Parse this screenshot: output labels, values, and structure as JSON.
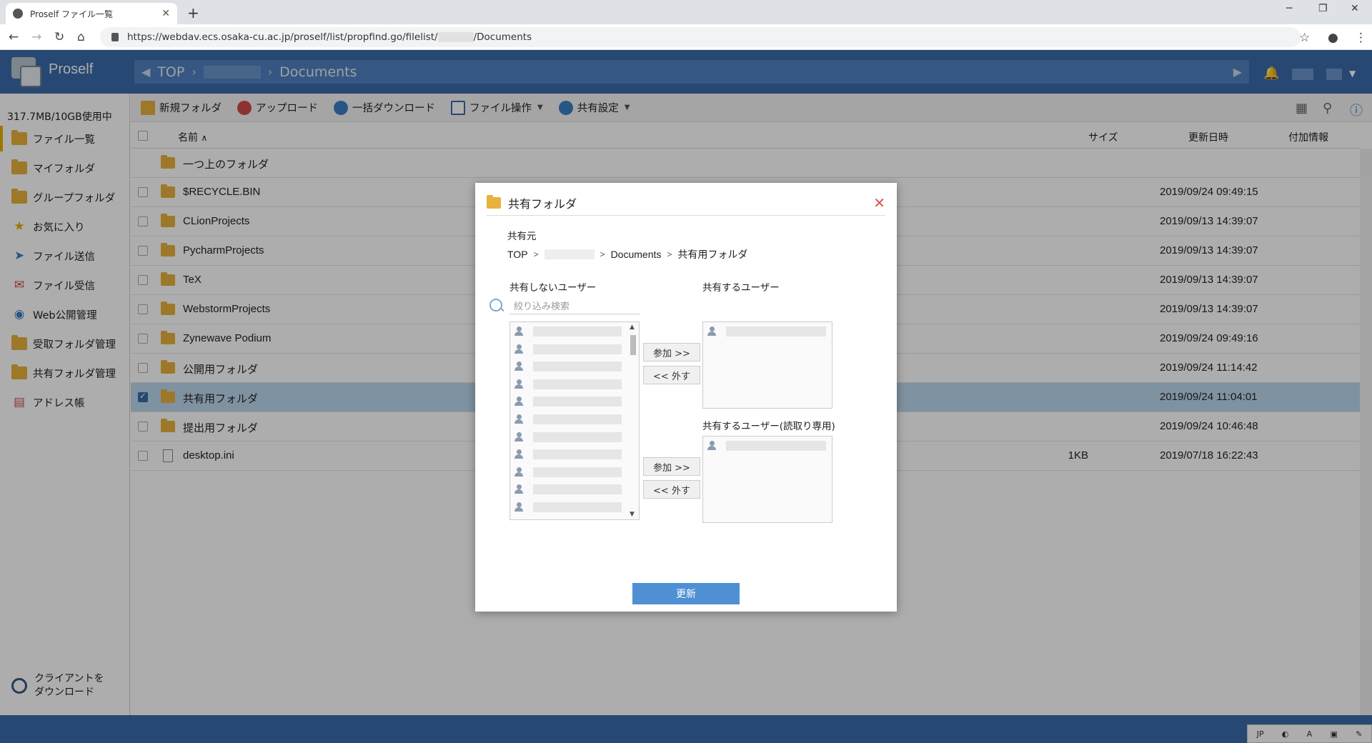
{
  "browser": {
    "tab_title": "Proself ファイル一覧",
    "url_prefix": "https://webdav.ecs.osaka-cu.ac.jp/proself/list/propfind.go/filelist/",
    "url_suffix": "/Documents"
  },
  "app": {
    "brand": "Proself",
    "breadcrumb": {
      "top": "TOP",
      "documents": "Documents"
    }
  },
  "sidebar": {
    "quota": "317.7MB/10GB使用中",
    "items": [
      {
        "label": "ファイル一覧",
        "icon": "folder-icon"
      },
      {
        "label": "マイフォルダ",
        "icon": "user-folder-icon"
      },
      {
        "label": "グループフォルダ",
        "icon": "group-folder-icon"
      },
      {
        "label": "お気に入り",
        "icon": "star-icon"
      },
      {
        "label": "ファイル送信",
        "icon": "send-icon"
      },
      {
        "label": "ファイル受信",
        "icon": "mailbox-icon"
      },
      {
        "label": "Web公開管理",
        "icon": "globe-icon"
      },
      {
        "label": "受取フォルダ管理",
        "icon": "receive-folder-icon"
      },
      {
        "label": "共有フォルダ管理",
        "icon": "shared-folder-icon"
      },
      {
        "label": "アドレス帳",
        "icon": "address-book-icon"
      }
    ],
    "client_download": [
      "クライアントを",
      "ダウンロード"
    ]
  },
  "toolbar": {
    "new_folder": "新規フォルダ",
    "upload": "アップロード",
    "bulk_download": "一括ダウンロード",
    "file_ops": "ファイル操作",
    "share_settings": "共有設定"
  },
  "list": {
    "headers": {
      "name": "名前",
      "size": "サイズ",
      "modified": "更新日時",
      "extra": "付加情報"
    },
    "rows": [
      {
        "name": "一つ上のフォルダ",
        "size": "",
        "date": "",
        "icon": "folder-icon",
        "selected": false,
        "has_checkbox": false
      },
      {
        "name": "$RECYCLE.BIN",
        "size": "",
        "date": "2019/09/24 09:49:15",
        "icon": "folder-icon",
        "selected": false,
        "has_checkbox": true
      },
      {
        "name": "CLionProjects",
        "size": "",
        "date": "2019/09/13 14:39:07",
        "icon": "folder-icon",
        "selected": false,
        "has_checkbox": true
      },
      {
        "name": "PycharmProjects",
        "size": "",
        "date": "2019/09/13 14:39:07",
        "icon": "folder-icon",
        "selected": false,
        "has_checkbox": true
      },
      {
        "name": "TeX",
        "size": "",
        "date": "2019/09/13 14:39:07",
        "icon": "folder-icon",
        "selected": false,
        "has_checkbox": true
      },
      {
        "name": "WebstormProjects",
        "size": "",
        "date": "2019/09/13 14:39:07",
        "icon": "folder-icon",
        "selected": false,
        "has_checkbox": true
      },
      {
        "name": "Zynewave Podium",
        "size": "",
        "date": "2019/09/24 09:49:16",
        "icon": "folder-icon",
        "selected": false,
        "has_checkbox": true
      },
      {
        "name": "公開用フォルダ",
        "size": "",
        "date": "2019/09/24 11:14:42",
        "icon": "folder-icon",
        "selected": false,
        "has_checkbox": true
      },
      {
        "name": "共有用フォルダ",
        "size": "",
        "date": "2019/09/24 11:04:01",
        "icon": "shared-folder-icon",
        "selected": true,
        "has_checkbox": true
      },
      {
        "name": "提出用フォルダ",
        "size": "",
        "date": "2019/09/24 10:46:48",
        "icon": "folder-icon",
        "selected": false,
        "has_checkbox": true
      },
      {
        "name": "desktop.ini",
        "size": "1KB",
        "date": "2019/07/18 16:22:43",
        "icon": "file-icon",
        "selected": false,
        "has_checkbox": true
      }
    ]
  },
  "modal": {
    "title": "共有フォルダ",
    "source_label": "共有元",
    "path": {
      "top": "TOP",
      "documents": "Documents",
      "folder": "共有用フォルダ"
    },
    "non_shared_label": "共有しないユーザー",
    "filter_placeholder": "絞り込み検索",
    "shared_label": "共有するユーザー",
    "readonly_label": "共有するユーザー(読取り専用)",
    "add_label": "参加 >>",
    "remove_label": "<< 外す",
    "update_label": "更新"
  },
  "colors": {
    "header": "#3a6aa8",
    "accent": "#4f8fd4",
    "folder": "#e8b23d",
    "selected_row": "#bcd8ef"
  }
}
